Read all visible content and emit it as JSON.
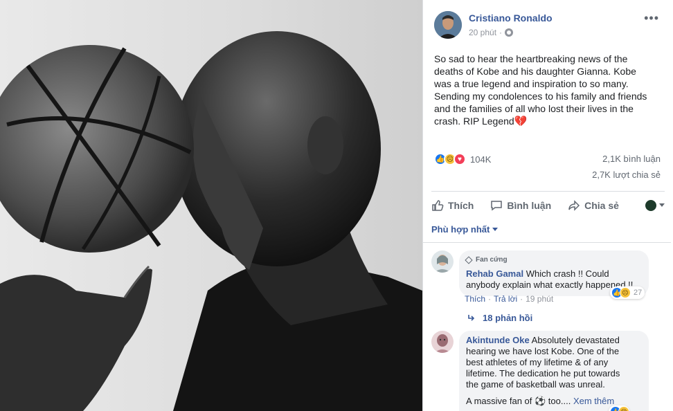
{
  "post": {
    "author": "Cristiano Ronaldo",
    "time": "20 phút",
    "more_icon": "more-horizontal-icon",
    "text": "So sad to hear the heartbreaking news of the\ndeaths of Kobe and his daughter Gianna. Kobe\nwas a true legend and inspiration to so many.\nSending my condolences to his family and friends\nand the families of all who lost their lives in the\ncrash. RIP Legend",
    "text_emoji": "💔",
    "reactions": [
      "like-icon",
      "sad-icon",
      "love-icon"
    ],
    "reaction_count": "104K",
    "comments_count": "2,1K bình luận",
    "shares_count": "2,7K lượt chia sẻ"
  },
  "actions": {
    "like": "Thích",
    "comment": "Bình luận",
    "share": "Chia sẻ"
  },
  "sort_label": "Phù hợp nhất",
  "comments": [
    {
      "badge": "Fan cứng",
      "name": "Rehab Gamal",
      "text": "Which crash !! Could\nanybody explain what exactly happened !!",
      "like": "Thích",
      "reply": "Trả lời",
      "time": "19 phút",
      "reaction_count": "27",
      "replies": "18 phản hồi"
    },
    {
      "name": "Akintunde Oke",
      "text": "Absolutely devastated\nhearing we have lost Kobe. One of the\nbest athletes of my lifetime & of any\nlifetime. The dedication he put towards\nthe game of basketball was unreal.",
      "text2": "A massive fan of ⚽ too....",
      "see_more": "Xem thêm"
    }
  ],
  "colors": {
    "link": "#385898",
    "muted": "#90949c",
    "bubble": "#f2f3f5",
    "like_blue": "#1877f2",
    "love_red": "#f33e58",
    "sad_yellow": "#f7c33b"
  }
}
